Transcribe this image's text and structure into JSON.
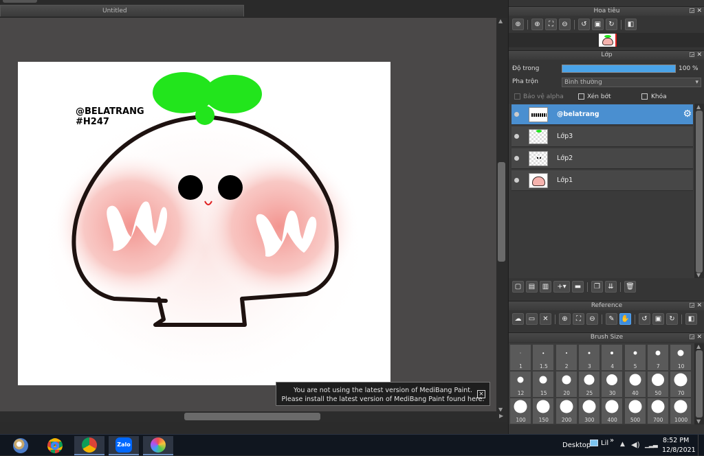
{
  "document": {
    "tab_title": "Untitled"
  },
  "canvas_text": {
    "watermark_line1": "@BELATRANG",
    "watermark_line2": "#H247"
  },
  "notice": {
    "line1": "You are not using the latest version of MediBang Paint.",
    "line2": "Please install the latest version of MediBang Paint found here.",
    "close_glyph": "×"
  },
  "navigator": {
    "title": "Hoa tiêu",
    "tools": [
      "zoom-fit-icon",
      "zoom-in-icon",
      "fit-window-icon",
      "zoom-out-icon",
      "rotate-left-icon",
      "actual-size-icon",
      "rotate-right-icon",
      "flip-icon"
    ]
  },
  "layer_panel": {
    "title": "Lớp",
    "opacity_label": "Độ trong",
    "opacity_value": "100 %",
    "opacity_fraction": 1.0,
    "blend_label": "Pha trộn",
    "blend_value": "Bình thường",
    "protect_alpha": "Bảo vệ alpha",
    "clipping": "Xén bớt",
    "lock": "Khóa",
    "layers": [
      {
        "name": "@belatrang",
        "selected": true
      },
      {
        "name": "Lớp3",
        "selected": false
      },
      {
        "name": "Lớp2",
        "selected": false
      },
      {
        "name": "Lớp1",
        "selected": false
      }
    ],
    "tools": [
      "new-layer-icon",
      "new-halftone-layer-icon",
      "new-8bit-layer-icon",
      "add-layer-menu-icon",
      "new-folder-icon",
      "duplicate-layer-icon",
      "merge-down-icon",
      "delete-layer-icon"
    ]
  },
  "reference": {
    "title": "Reference",
    "tools": [
      "open-cloud-icon",
      "open-folder-icon",
      "close-icon",
      "zoom-in-icon",
      "fit-icon",
      "zoom-out-icon",
      "eyedropper-icon",
      "hand-icon",
      "rotate-left-icon",
      "actual-size-icon",
      "rotate-right-icon",
      "flip-icon"
    ]
  },
  "brush_size": {
    "title": "Brush Size",
    "sizes": [
      "1",
      "1.5",
      "2",
      "3",
      "4",
      "5",
      "7",
      "10",
      "12",
      "15",
      "20",
      "25",
      "30",
      "40",
      "50",
      "70",
      "100",
      "150",
      "200",
      "300",
      "400",
      "500",
      "700",
      "1000"
    ]
  },
  "window_controls": {
    "float": "◲",
    "close": "✕"
  },
  "taskbar": {
    "desktop_label": "Desktop",
    "lil_label": "Lil",
    "chevrons": "»",
    "time": "8:52 PM",
    "date": "12/8/2021",
    "zalo": "Zalo"
  },
  "colors": {
    "accent": "#3d8ee0",
    "selected_layer": "#4a8fd0",
    "sprout": "#22e51c",
    "blush": "#f4a3a0"
  }
}
